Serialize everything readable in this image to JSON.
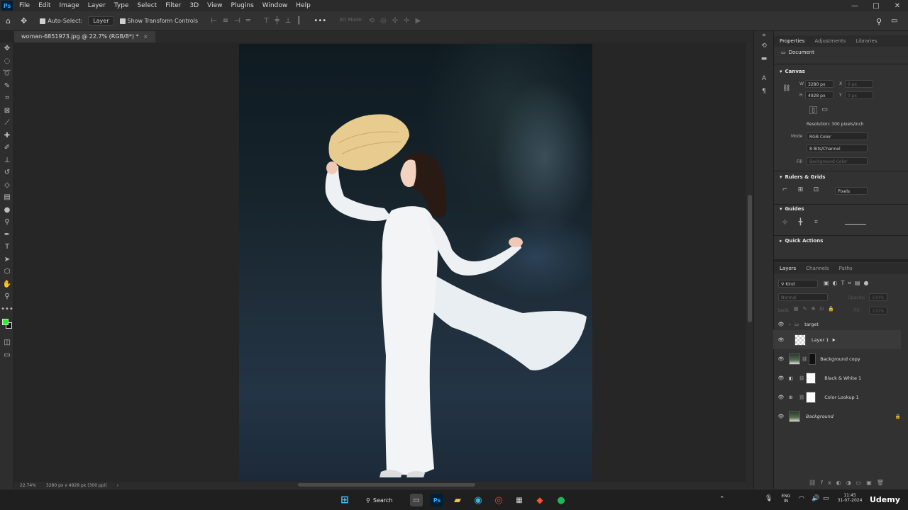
{
  "menu": {
    "logo": "Ps",
    "items": [
      "File",
      "Edit",
      "Image",
      "Layer",
      "Type",
      "Select",
      "Filter",
      "3D",
      "View",
      "Plugins",
      "Window",
      "Help"
    ],
    "window_controls": [
      "—",
      "□",
      "✕"
    ]
  },
  "options_bar": {
    "auto_select_label": "Auto-Select:",
    "auto_select_target": "Layer",
    "show_transform_label": "Show Transform Controls",
    "mode_3d_label": "3D Mode:"
  },
  "document": {
    "tab_title": "woman-6851973.jpg @ 22.7% (RGB/8*) *"
  },
  "status": {
    "zoom": "22.74%",
    "doc_info": "3280 px x 4928 px (300 ppi)"
  },
  "properties": {
    "tabs": [
      "Properties",
      "Adjustments",
      "Libraries"
    ],
    "doc_label": "Document",
    "canvas_section": "Canvas",
    "width_label": "W",
    "width_value": "3280 px",
    "height_label": "H",
    "height_value": "4928 px",
    "x_label": "X",
    "x_value": "0 px",
    "y_label": "Y",
    "y_value": "0 px",
    "resolution": "Resolution: 300 pixels/inch",
    "mode_label": "Mode",
    "mode_value": "RGB Color",
    "bits_value": "8 Bits/Channel",
    "fill_label": "Fill",
    "fill_value": "Background Color",
    "rulers_section": "Rulers & Grids",
    "units_value": "Pixels",
    "guides_section": "Guides",
    "quick_actions_section": "Quick Actions"
  },
  "layers_panel": {
    "tabs": [
      "Layers",
      "Channels",
      "Paths"
    ],
    "kind_label": "Kind",
    "blend_mode": "Normal",
    "opacity_label": "Opacity:",
    "opacity_value": "100%",
    "lock_label": "Lock:",
    "fill_label": "Fill:",
    "fill_value": "100%",
    "layers": [
      {
        "name": "target",
        "type": "group"
      },
      {
        "name": "Layer 1",
        "type": "transparent"
      },
      {
        "name": "Background copy",
        "type": "photo-mask"
      },
      {
        "name": "Black & White 1",
        "type": "adjustment"
      },
      {
        "name": "Color Lookup 1",
        "type": "adjustment"
      },
      {
        "name": "Background",
        "type": "photo-locked"
      }
    ]
  },
  "taskbar": {
    "search_label": "Search",
    "language": "ENG",
    "region": "IN",
    "time": "11:45",
    "date": "31-07-2024",
    "watermark": "Udemy"
  },
  "colors": {
    "foreground": "#1aff1a",
    "background": "#111111",
    "ps_blue": "#31a8ff"
  }
}
